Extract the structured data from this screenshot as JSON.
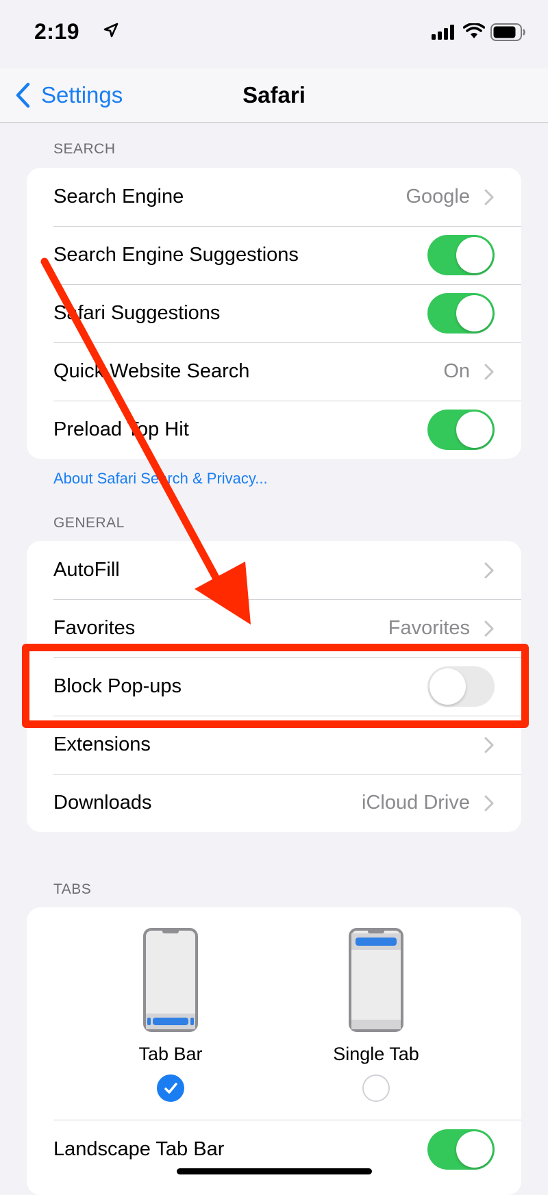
{
  "status_bar": {
    "time": "2:19",
    "icons": [
      "location-arrow-icon",
      "signal-bars-icon",
      "wifi-icon",
      "battery-icon"
    ]
  },
  "nav": {
    "back_label": "Settings",
    "title": "Safari"
  },
  "search_section": {
    "header": "SEARCH",
    "rows": [
      {
        "label": "Search Engine",
        "value": "Google",
        "control": "chevron"
      },
      {
        "label": "Search Engine Suggestions",
        "control": "toggle",
        "on": true
      },
      {
        "label": "Safari Suggestions",
        "control": "toggle",
        "on": true
      },
      {
        "label": "Quick Website Search",
        "value": "On",
        "control": "chevron"
      },
      {
        "label": "Preload Top Hit",
        "control": "toggle",
        "on": true
      }
    ],
    "footer_link": "About Safari Search & Privacy..."
  },
  "general_section": {
    "header": "GENERAL",
    "rows": [
      {
        "label": "AutoFill",
        "value": "",
        "control": "chevron"
      },
      {
        "label": "Favorites",
        "value": "Favorites",
        "control": "chevron"
      },
      {
        "label": "Block Pop-ups",
        "control": "toggle",
        "on": false
      },
      {
        "label": "Extensions",
        "value": "",
        "control": "chevron"
      },
      {
        "label": "Downloads",
        "value": "iCloud Drive",
        "control": "chevron"
      }
    ]
  },
  "tabs_section": {
    "header": "TABS",
    "options": [
      {
        "label": "Tab Bar",
        "selected": true
      },
      {
        "label": "Single Tab",
        "selected": false
      }
    ],
    "landscape_row": {
      "label": "Landscape Tab Bar",
      "on": true
    }
  },
  "colors": {
    "accent": "#1a7ef2",
    "toggle_on": "#34c759",
    "annotation": "#ff2a00"
  }
}
